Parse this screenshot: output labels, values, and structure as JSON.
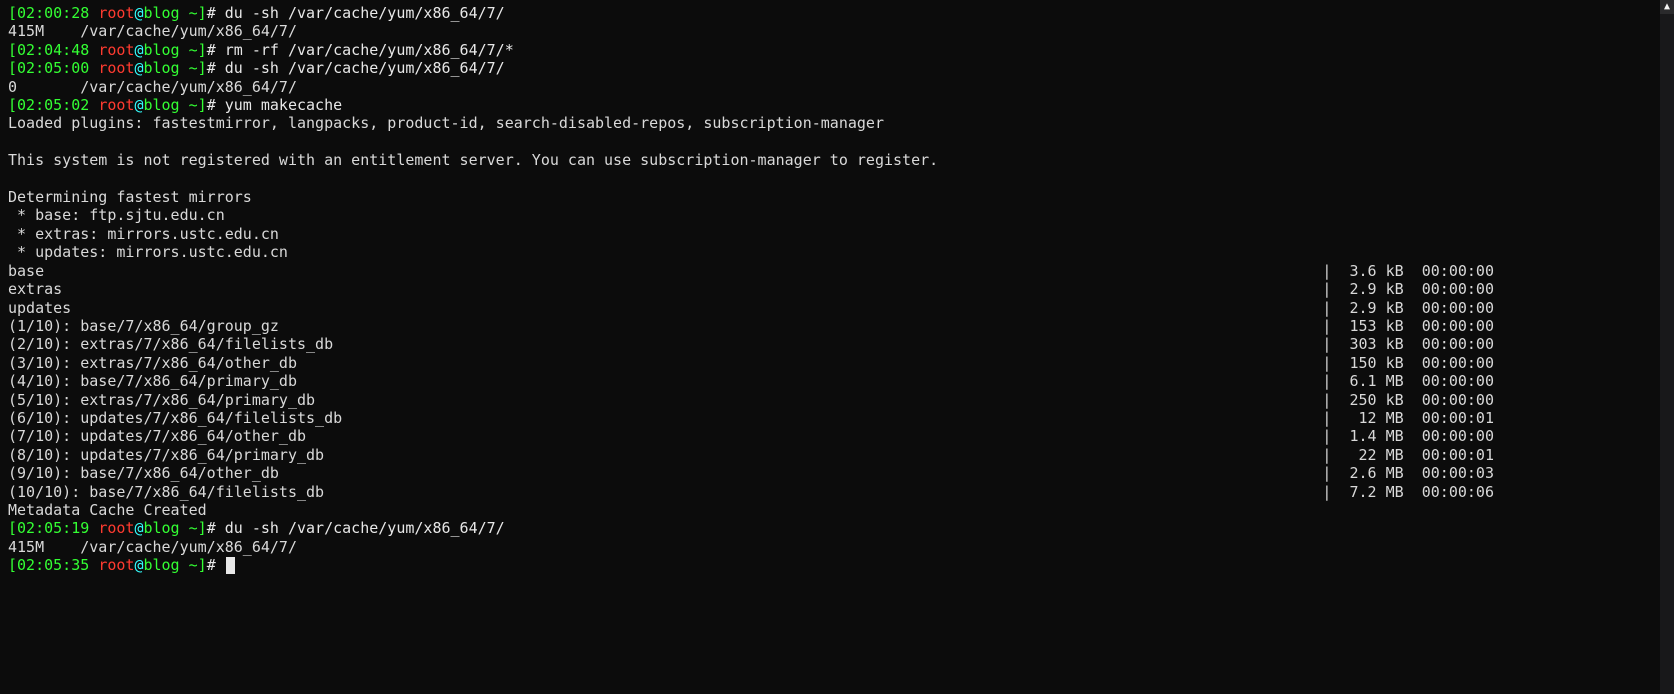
{
  "prompt": {
    "open": "[",
    "at": "@",
    "host": "blog",
    "cwd": " ~",
    "close": "]# "
  },
  "user": "root",
  "entries": [
    {
      "t": "prompt",
      "time": "02:00:28",
      "cmd": "du -sh /var/cache/yum/x86_64/7/"
    },
    {
      "t": "out",
      "text": "415M    /var/cache/yum/x86_64/7/"
    },
    {
      "t": "prompt",
      "time": "02:04:48",
      "cmd": "rm -rf /var/cache/yum/x86_64/7/*"
    },
    {
      "t": "prompt",
      "time": "02:05:00",
      "cmd": "du -sh /var/cache/yum/x86_64/7/"
    },
    {
      "t": "out",
      "text": "0       /var/cache/yum/x86_64/7/"
    },
    {
      "t": "prompt",
      "time": "02:05:02",
      "cmd": "yum makecache"
    },
    {
      "t": "out",
      "text": "Loaded plugins: fastestmirror, langpacks, product-id, search-disabled-repos, subscription-manager"
    },
    {
      "t": "blank"
    },
    {
      "t": "out",
      "text": "This system is not registered with an entitlement server. You can use subscription-manager to register."
    },
    {
      "t": "blank"
    },
    {
      "t": "out",
      "text": "Determining fastest mirrors"
    },
    {
      "t": "out",
      "text": " * base: ftp.sjtu.edu.cn"
    },
    {
      "t": "out",
      "text": " * extras: mirrors.ustc.edu.cn"
    },
    {
      "t": "out",
      "text": " * updates: mirrors.ustc.edu.cn"
    },
    {
      "t": "dl",
      "left": "base",
      "size": "3.6 kB",
      "time": "00:00:00"
    },
    {
      "t": "dl",
      "left": "extras",
      "size": "2.9 kB",
      "time": "00:00:00"
    },
    {
      "t": "dl",
      "left": "updates",
      "size": "2.9 kB",
      "time": "00:00:00"
    },
    {
      "t": "dl",
      "left": "(1/10): base/7/x86_64/group_gz",
      "size": "153 kB",
      "time": "00:00:00"
    },
    {
      "t": "dl",
      "left": "(2/10): extras/7/x86_64/filelists_db",
      "size": "303 kB",
      "time": "00:00:00"
    },
    {
      "t": "dl",
      "left": "(3/10): extras/7/x86_64/other_db",
      "size": "150 kB",
      "time": "00:00:00"
    },
    {
      "t": "dl",
      "left": "(4/10): base/7/x86_64/primary_db",
      "size": "6.1 MB",
      "time": "00:00:00"
    },
    {
      "t": "dl",
      "left": "(5/10): extras/7/x86_64/primary_db",
      "size": "250 kB",
      "time": "00:00:00"
    },
    {
      "t": "dl",
      "left": "(6/10): updates/7/x86_64/filelists_db",
      "size": " 12 MB",
      "time": "00:00:01"
    },
    {
      "t": "dl",
      "left": "(7/10): updates/7/x86_64/other_db",
      "size": "1.4 MB",
      "time": "00:00:00"
    },
    {
      "t": "dl",
      "left": "(8/10): updates/7/x86_64/primary_db",
      "size": " 22 MB",
      "time": "00:00:01"
    },
    {
      "t": "dl",
      "left": "(9/10): base/7/x86_64/other_db",
      "size": "2.6 MB",
      "time": "00:00:03"
    },
    {
      "t": "dl",
      "left": "(10/10): base/7/x86_64/filelists_db",
      "size": "7.2 MB",
      "time": "00:00:06"
    },
    {
      "t": "out",
      "text": "Metadata Cache Created"
    },
    {
      "t": "prompt",
      "time": "02:05:19",
      "cmd": "du -sh /var/cache/yum/x86_64/7/"
    },
    {
      "t": "out",
      "text": "415M    /var/cache/yum/x86_64/7/"
    },
    {
      "t": "prompt",
      "time": "02:05:35",
      "cmd": "",
      "cursor": true
    }
  ],
  "dl_sep": "| ",
  "dl_gap": "  "
}
